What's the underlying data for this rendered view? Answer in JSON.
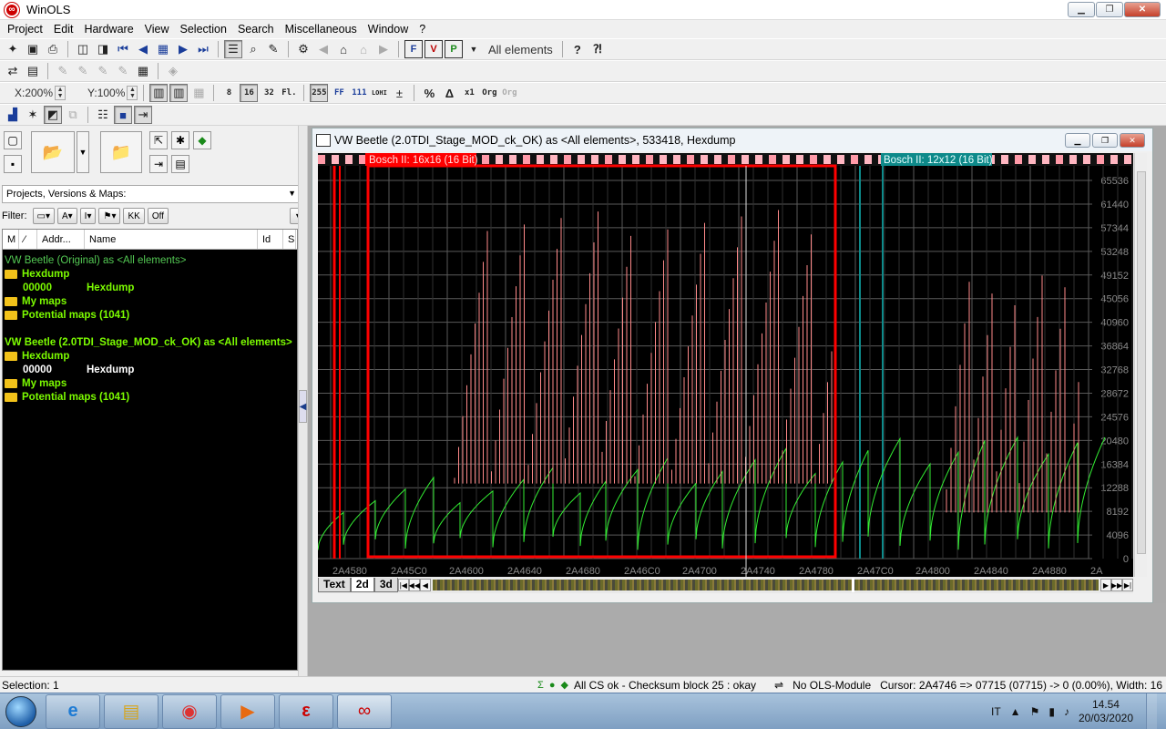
{
  "app": {
    "title": "WinOLS",
    "logo_glyph": "∞"
  },
  "window_controls": {
    "minimize": "▁",
    "maximize": "❐",
    "close": "✕"
  },
  "menu": [
    "Project",
    "Edit",
    "Hardware",
    "View",
    "Selection",
    "Search",
    "Miscellaneous",
    "Window",
    "?"
  ],
  "toolbar1": {
    "elements_label": "All elements"
  },
  "toolbar3": {
    "zoom_x": "X:200%",
    "zoom_y": "Y:100%",
    "btn_8": "8",
    "btn_16": "16",
    "btn_32": "32",
    "btn_fl": "Fl.",
    "btn_255": "255",
    "btn_ff": "FF",
    "btn_111": "111",
    "btn_lohi": "LOHI",
    "btn_x1": "x1",
    "btn_org": "Org",
    "btn_org2": "Org"
  },
  "left": {
    "combo_value": "Projects, Versions & Maps:",
    "filter_label": "Filter:",
    "filter_off": "Off",
    "columns": [
      "M",
      "⁄",
      "Addr...",
      "Name",
      "Id",
      "S"
    ],
    "tree": [
      {
        "text": "VW Beetle (Original) as <All elements>",
        "kind": "plain"
      },
      {
        "text": "Hexdump",
        "kind": "folder"
      },
      {
        "addr": "00000",
        "name": "Hexdump",
        "kind": "entry"
      },
      {
        "text": "My maps",
        "kind": "folder"
      },
      {
        "text": "Potential maps (1041)",
        "kind": "folder"
      },
      {
        "text": "",
        "kind": "gap"
      },
      {
        "text": "VW Beetle (2.0TDI_Stage_MOD_ck_OK) as <All elements>",
        "kind": "bold"
      },
      {
        "text": "Hexdump",
        "kind": "folder"
      },
      {
        "addr": "00000",
        "name": "Hexdump",
        "kind": "entry-white"
      },
      {
        "text": "My maps",
        "kind": "folder"
      },
      {
        "text": "Potential maps (1041)",
        "kind": "folder"
      }
    ]
  },
  "child": {
    "title": "VW Beetle (2.0TDI_Stage_MOD_ck_OK) as <All elements>, 533418, Hexdump",
    "map1_label": "Bosch II: 16x16 (16 Bit)",
    "map2_label": "Bosch II: 12x12 (16 Bit)",
    "tabs": [
      "Text",
      "2d",
      "3d"
    ]
  },
  "chart_data": {
    "type": "line",
    "x_tick_labels": [
      "2A4580",
      "2A45C0",
      "2A4600",
      "2A4640",
      "2A4680",
      "2A46C0",
      "2A4700",
      "2A4740",
      "2A4780",
      "2A47C0",
      "2A4800",
      "2A4840",
      "2A4880",
      "2A"
    ],
    "y_tick_labels": [
      "65536",
      "61440",
      "57344",
      "53248",
      "49152",
      "45056",
      "40960",
      "36864",
      "32768",
      "28672",
      "24576",
      "20480",
      "16384",
      "12288",
      "8192",
      "4096",
      "0"
    ],
    "ylim": [
      0,
      65536
    ],
    "grid": true,
    "colors": {
      "background": "#000000",
      "grid": "#5a5a5a",
      "ramp": "#33ee33",
      "spikes": "#ff8a8a",
      "map1": "#ff0000",
      "map2": "#0e8a8a"
    }
  },
  "status": {
    "selection": "Selection: 1",
    "checksum": "All CS ok - Checksum block 25 : okay",
    "module": "No OLS-Module",
    "cursor": "Cursor: 2A4746 => 07715 (07715) -> 0 (0.00%), Width: 16"
  },
  "taskbar": {
    "apps": [
      "ie-icon",
      "file-explorer-icon",
      "chrome-icon",
      "media-player-icon",
      "evc-app-icon",
      "winols-icon"
    ],
    "lang": "IT",
    "time": "14.54",
    "date": "20/03/2020"
  }
}
